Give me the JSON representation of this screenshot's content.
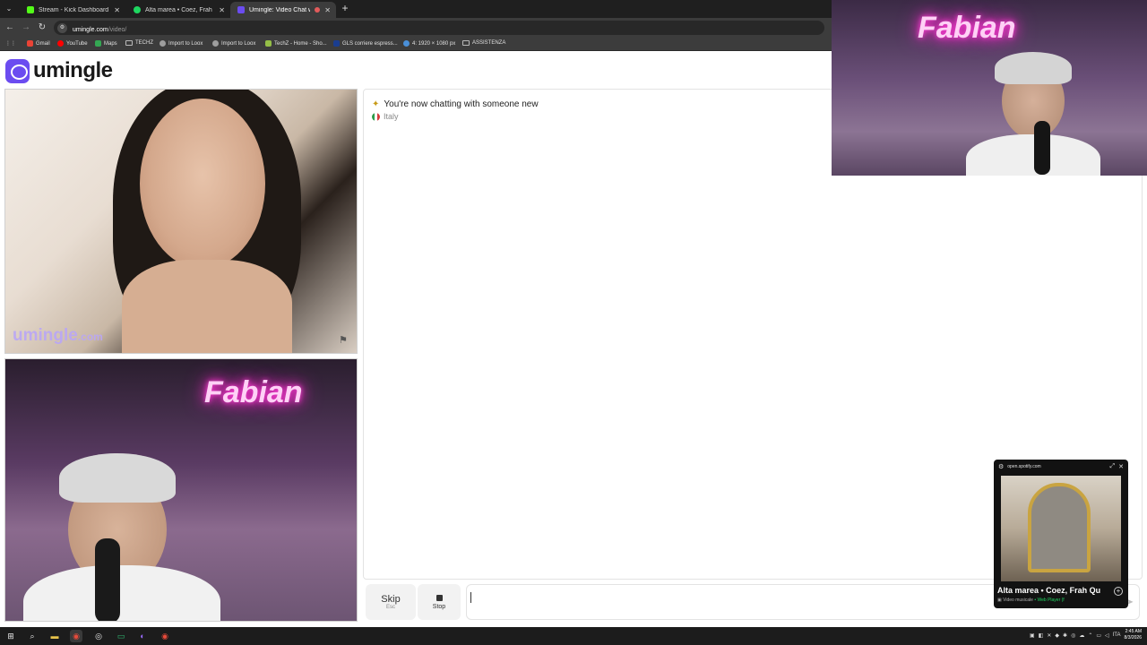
{
  "browser": {
    "tabs": [
      {
        "title": "Stream - Kick Dashboard",
        "favicon_color": "#53fc18",
        "active": false
      },
      {
        "title": "Alta marea • Coez, Frah Qu",
        "favicon_color": "#1ed760",
        "active": false
      },
      {
        "title": "Umingle: Video Chat with S",
        "favicon_color": "#6b4cf0",
        "active": true
      }
    ],
    "close_glyph": "✕",
    "new_tab_glyph": "+",
    "url_domain": "umingle.com",
    "url_path": "/video/",
    "bookmarks": [
      {
        "label": "Gmail",
        "icon": "gmail-icon",
        "color": "#ea4335"
      },
      {
        "label": "YouTube",
        "icon": "youtube-icon",
        "color": "#ff0000"
      },
      {
        "label": "Maps",
        "icon": "maps-icon",
        "color": "#34a853"
      },
      {
        "label": "TECHZ",
        "icon": "folder-icon",
        "color": ""
      },
      {
        "label": "Import to Loox",
        "icon": "globe-icon",
        "color": "#9e9e9e"
      },
      {
        "label": "Import to Loox",
        "icon": "globe-icon",
        "color": "#9e9e9e"
      },
      {
        "label": "TechZ - Home - Sho...",
        "icon": "shopify-icon",
        "color": "#95bf47"
      },
      {
        "label": "GLS corriere espress...",
        "icon": "gls-icon",
        "color": "#1a3d8f"
      },
      {
        "label": "4: 1920 × 1080 px",
        "icon": "image-icon",
        "color": "#4a90d9"
      },
      {
        "label": "ASSISTENZA",
        "icon": "folder-icon",
        "color": ""
      }
    ]
  },
  "site": {
    "logo_text": "umingle",
    "brand_color": "#6b4cf0",
    "watermark_main": "umingle",
    "watermark_suffix": ".com"
  },
  "chat": {
    "system_message": "You're now chatting with someone new",
    "partner_country": "Italy"
  },
  "controls": {
    "skip_label": "Skip",
    "skip_key": "Esc",
    "stop_label": "Stop"
  },
  "streamer": {
    "neon_sign": "Fabian"
  },
  "spotify_pip": {
    "domain": "open.spotify.com",
    "track_title": "Alta marea • Coez, Frah Qu",
    "subtitle_type": "Video musicale",
    "subtitle_source": "Web Player (f"
  },
  "taskbar": {
    "language": "ITA",
    "time": "2:45 AM",
    "date": "8/3/2026"
  }
}
